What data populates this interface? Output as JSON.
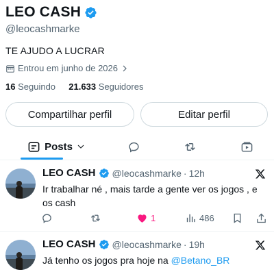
{
  "profile": {
    "display_name": "LEO CASH",
    "handle": "@leocashmarke",
    "bio": "TE AJUDO A LUCRAR",
    "joined": "Entrou em junho de 2026",
    "following_count": "16",
    "following_label": "Seguindo",
    "followers_count": "21.633",
    "followers_label": "Seguidores",
    "verified_color": "#1d9bf0"
  },
  "buttons": {
    "share": "Compartilhar perfil",
    "edit": "Editar perfil"
  },
  "tabs": {
    "posts_label": "Posts",
    "icons": [
      "list-icon",
      "speech-bubble-icon",
      "retweet-icon",
      "video-icon"
    ]
  },
  "tweets": [
    {
      "name": "LEO CASH",
      "handle": "@leocashmarke",
      "dot": "·",
      "time": "12h",
      "text": "Ir trabalhar né , mais tarde a gente ver os jogos , e os cash",
      "likes": "1",
      "views": "486"
    },
    {
      "name": "LEO CASH",
      "handle": "@leocashmarke",
      "dot": "·",
      "time": "19h",
      "text_prefix": "Já tenho os jogos pra hoje na ",
      "mention": "@Betano_BR"
    }
  ],
  "colors": {
    "accent": "#1d9bf0",
    "like": "#f91880",
    "muted": "#536471",
    "text": "#0f1419"
  }
}
